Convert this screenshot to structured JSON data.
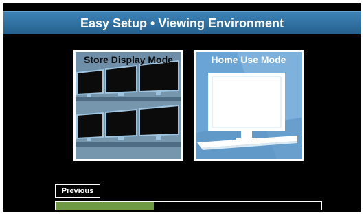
{
  "title": "Easy Setup • Viewing Environment",
  "modes": [
    {
      "label": "Store Display Mode",
      "selected": false
    },
    {
      "label": "Home Use Mode",
      "selected": true
    }
  ],
  "previous_label": "Previous",
  "progress": 0.37,
  "colors": {
    "title_bar": "#2f6f9f",
    "background": "#000000",
    "selected_card": "#6aa4d4",
    "unselected_card": "#6e8fa7",
    "progress_fill": "#6e9a44"
  },
  "icons": {
    "store_mode": "wall-of-monitors-icon",
    "home_mode": "single-monitor-icon"
  }
}
